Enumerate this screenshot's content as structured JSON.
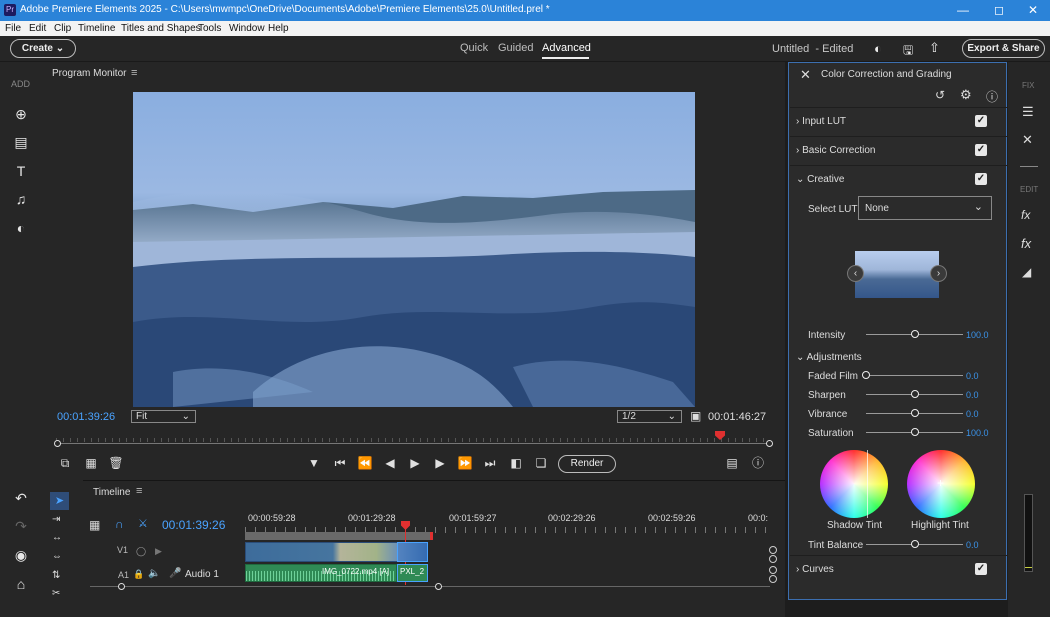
{
  "titlebar": {
    "title": "Adobe Premiere Elements 2025 - C:\\Users\\mwmpc\\OneDrive\\Documents\\Adobe\\Premiere Elements\\25.0\\Untitled.prel *"
  },
  "menu": [
    "File",
    "Edit",
    "Clip",
    "Timeline",
    "Titles and Shapes",
    "Tools",
    "Window",
    "Help"
  ],
  "topbar": {
    "create_label": "Create",
    "modes": [
      "Quick",
      "Guided",
      "Advanced"
    ],
    "active_mode": "Advanced",
    "project_status": "Untitled  - Edited",
    "export_label": "Export & Share"
  },
  "leftrail": {
    "add_label": "ADD"
  },
  "monitor": {
    "title": "Program Monitor",
    "current_time": "00:01:39:26",
    "zoom_value": "Fit",
    "resolution_value": "1/2",
    "duration": "00:01:46:27",
    "render_label": "Render",
    "playhead_fraction": 0.93
  },
  "timeline": {
    "title": "Timeline",
    "current_time": "00:01:39:26",
    "ruler": [
      "00:00:59:28",
      "00:01:29:28",
      "00:01:59:27",
      "00:02:29:26",
      "00:02:59:26",
      "00:0:"
    ],
    "video_track_label": "V1",
    "audio_track_label_a": "A1",
    "audio_track_label": "Audio 1",
    "audio_clip_label": "IMG_0722.mp4 [A]",
    "audio_clip2_label": "PXL_2"
  },
  "panel": {
    "title": "Color Correction and Grading",
    "sections": {
      "input_lut": "Input LUT",
      "basic_correction": "Basic Correction",
      "creative": "Creative",
      "curves": "Curves"
    },
    "select_lut_label": "Select LUT",
    "select_lut_value": "None",
    "intensity": {
      "label": "Intensity",
      "value": "100.0",
      "fraction": 0.5
    },
    "adjustments_label": "Adjustments",
    "sliders": [
      {
        "label": "Faded Film",
        "value": "0.0",
        "fraction": 0.0
      },
      {
        "label": "Sharpen",
        "value": "0.0",
        "fraction": 0.5
      },
      {
        "label": "Vibrance",
        "value": "0.0",
        "fraction": 0.5
      },
      {
        "label": "Saturation",
        "value": "100.0",
        "fraction": 0.5
      }
    ],
    "shadow_tint_label": "Shadow Tint",
    "highlight_tint_label": "Highlight Tint",
    "tint_balance": {
      "label": "Tint Balance",
      "value": "0.0",
      "fraction": 0.5
    }
  },
  "farright": {
    "fix_label": "FIX",
    "edit_label": "EDIT"
  },
  "colors": {
    "accent": "#2b83d8",
    "timecode": "#4aa3ff",
    "value_blue": "#3a92e8",
    "playhead": "#e03030"
  },
  "icons": [
    "add-media-icon",
    "project-assets-icon",
    "titles-icon",
    "music-icon",
    "graphics-icon",
    "undo-icon",
    "redo-icon",
    "organizer-icon",
    "home-icon"
  ]
}
